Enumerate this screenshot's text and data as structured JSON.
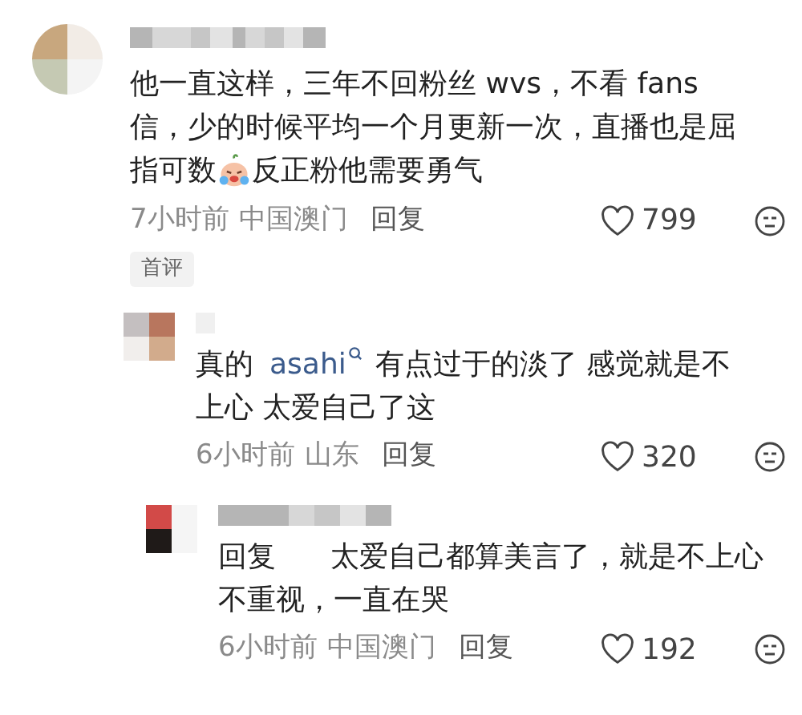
{
  "comments": [
    {
      "lines": [
        [
          {
            "kind": "text",
            "text": "他一直这样，三年不回粉丝 wvs，不看 fans"
          }
        ],
        [
          {
            "kind": "text",
            "text": "信，少的时候平均一个月更新一次，直播也是屈"
          }
        ],
        [
          {
            "kind": "text",
            "text": "指可数"
          },
          {
            "kind": "emoji"
          },
          {
            "kind": "text",
            "text": "反正粉他需要勇气"
          }
        ]
      ],
      "time": "7小时前",
      "location": "中国澳门",
      "reply": "回复",
      "likes": "799",
      "badge": "首评",
      "replies": [
        {
          "lines": [
            [
              {
                "kind": "text",
                "text": "真的"
              },
              {
                "kind": "mention",
                "text": "asahi"
              },
              {
                "kind": "text",
                "text": "有点过于的淡了 感觉就是不"
              }
            ],
            [
              {
                "kind": "text",
                "text": "上心 太爱自己了这"
              }
            ]
          ],
          "time": "6小时前",
          "location": "山东",
          "reply": "回复",
          "likes": "320"
        },
        {
          "lines": [
            [
              {
                "kind": "text",
                "text": "回复"
              },
              {
                "kind": "gap"
              },
              {
                "kind": "text",
                "text": "太爱自己都算美言了，就是不上心"
              }
            ],
            [
              {
                "kind": "text",
                "text": "不重视，一直在哭"
              }
            ]
          ],
          "time": "6小时前",
          "location": "中国澳门",
          "reply": "回复",
          "likes": "192"
        }
      ]
    }
  ]
}
